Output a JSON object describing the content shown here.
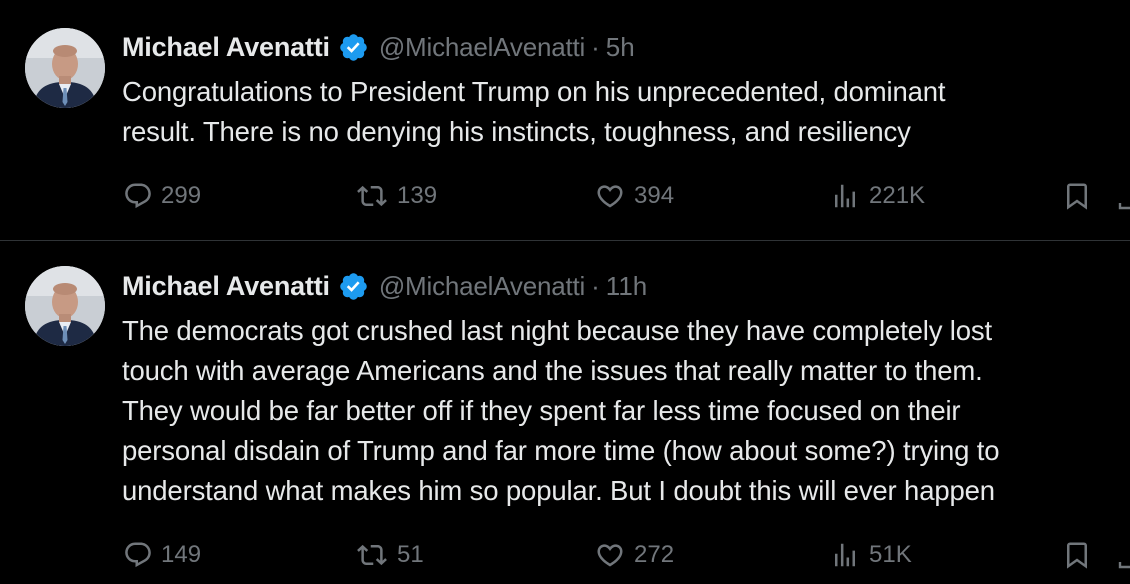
{
  "colors": {
    "background": "#000000",
    "primary_text": "#e7e9ea",
    "secondary_text": "#71767b",
    "verified_blue": "#1d9bf0",
    "divider": "#2f3336"
  },
  "tweets": [
    {
      "author_name": "Michael Avenatti",
      "handle": "@MichaelAvenatti",
      "separator": "·",
      "time": "5h",
      "verified_icon": "verified-badge-icon",
      "text_lines": [
        "Congratulations to President Trump on his unprecedented, dominant",
        "result. There is no denying his instincts, toughness, and resiliency"
      ],
      "replies": "299",
      "retweets": "139",
      "likes": "394",
      "views": "221K"
    },
    {
      "author_name": "Michael Avenatti",
      "handle": "@MichaelAvenatti",
      "separator": "·",
      "time": "11h",
      "verified_icon": "verified-badge-icon",
      "text_lines": [
        "The democrats got crushed last night because they have completely lost",
        "touch with average Americans and the issues that really matter to them.",
        "They would be far better off if they spent far less time focused on their",
        "personal disdain of Trump and far more time (how about some?) trying to",
        "understand what makes him so popular. But I doubt this will ever happen"
      ],
      "replies": "149",
      "retweets": "51",
      "likes": "272",
      "views": "51K"
    }
  ],
  "icons": {
    "reply": "reply-icon",
    "retweet": "retweet-icon",
    "like": "heart-icon",
    "views": "views-chart-icon",
    "bookmark": "bookmark-icon",
    "share": "share-icon"
  }
}
